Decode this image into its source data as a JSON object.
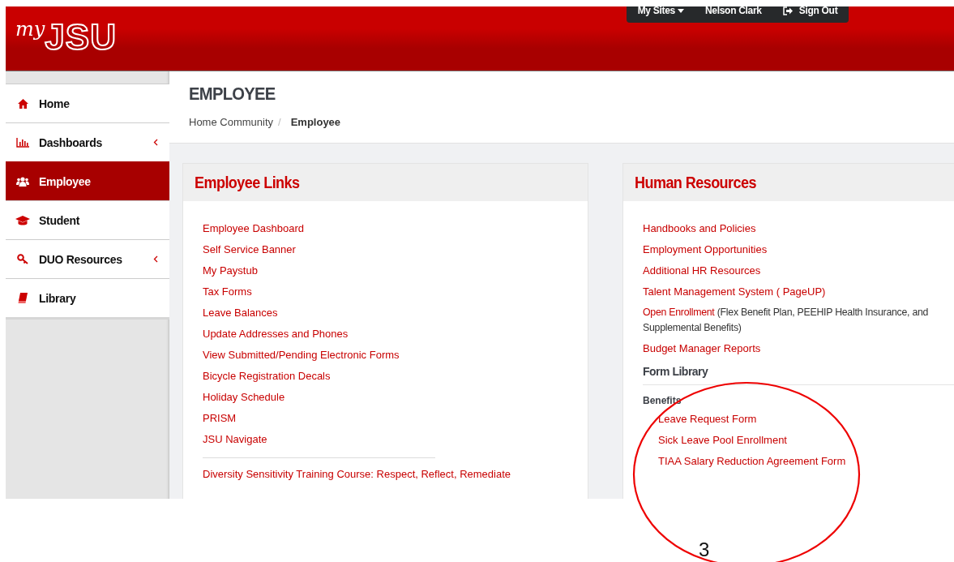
{
  "header": {
    "logo": {
      "script": "my",
      "letters": "JSU"
    },
    "user_menu": {
      "sites": "My Sites",
      "user": "Nelson Clark",
      "sign_out": "Sign Out"
    }
  },
  "sidebar": {
    "items": [
      {
        "label": "Home",
        "kind": "home",
        "selected": false,
        "submenu": false
      },
      {
        "label": "Dashboards",
        "kind": "chart",
        "selected": false,
        "submenu": true
      },
      {
        "label": "Employee",
        "kind": "users",
        "selected": true,
        "submenu": false
      },
      {
        "label": "Student",
        "kind": "cap",
        "selected": false,
        "submenu": false
      },
      {
        "label": "DUO Resources",
        "kind": "key",
        "selected": false,
        "submenu": true
      },
      {
        "label": "Library",
        "kind": "book",
        "selected": false,
        "submenu": false
      }
    ]
  },
  "page": {
    "title": "EMPLOYEE",
    "separator": "/",
    "breadcrumb": [
      {
        "label": "Home Community",
        "current": false
      },
      {
        "label": "Employee",
        "current": true
      }
    ]
  },
  "panels": [
    {
      "title": "Employee Links",
      "sections": [
        {
          "links": [
            {
              "label": "Employee Dashboard"
            },
            {
              "label": "Self Service Banner"
            },
            {
              "label": "My Paystub"
            },
            {
              "label": "Tax Forms"
            },
            {
              "label": "Leave Balances"
            },
            {
              "label": "Update Addresses and Phones"
            },
            {
              "label": "View Submitted/Pending Electronic Forms"
            },
            {
              "label": "Bicycle Registration Decals"
            },
            {
              "label": "Holiday Schedule"
            },
            {
              "label": "PRISM"
            },
            {
              "label": "JSU Navigate"
            }
          ]
        },
        {
          "divider": true,
          "links": [
            {
              "label": "Diversity Sensitivity Training Course: Respect, Reflect, Remediate"
            }
          ]
        }
      ]
    },
    {
      "title": "Human Resources",
      "sections": [
        {
          "links": [
            {
              "label": "Handbooks and Policies"
            },
            {
              "label": "Employment Opportunities"
            },
            {
              "label": "Additional HR Resources"
            },
            {
              "label": "Talent Management System ( PageUP)"
            },
            {
              "label": "Open Enrollment",
              "note_lines": [
                "(Flex Benefit Plan, PEEHIP Health Insurance, and",
                "Supplemental Benefits)"
              ]
            },
            {
              "label": "Budget Manager Reports"
            }
          ]
        },
        {
          "heading": "Form Library",
          "groups": [
            {
              "title": "Benefits",
              "links": [
                {
                  "label": "Leave Request Form"
                },
                {
                  "label": "Sick Leave Pool Enrollment"
                },
                {
                  "label": "TIAA Salary Reduction Agreement Form"
                }
              ]
            }
          ]
        }
      ]
    }
  ],
  "annotation": {
    "label": "3"
  }
}
